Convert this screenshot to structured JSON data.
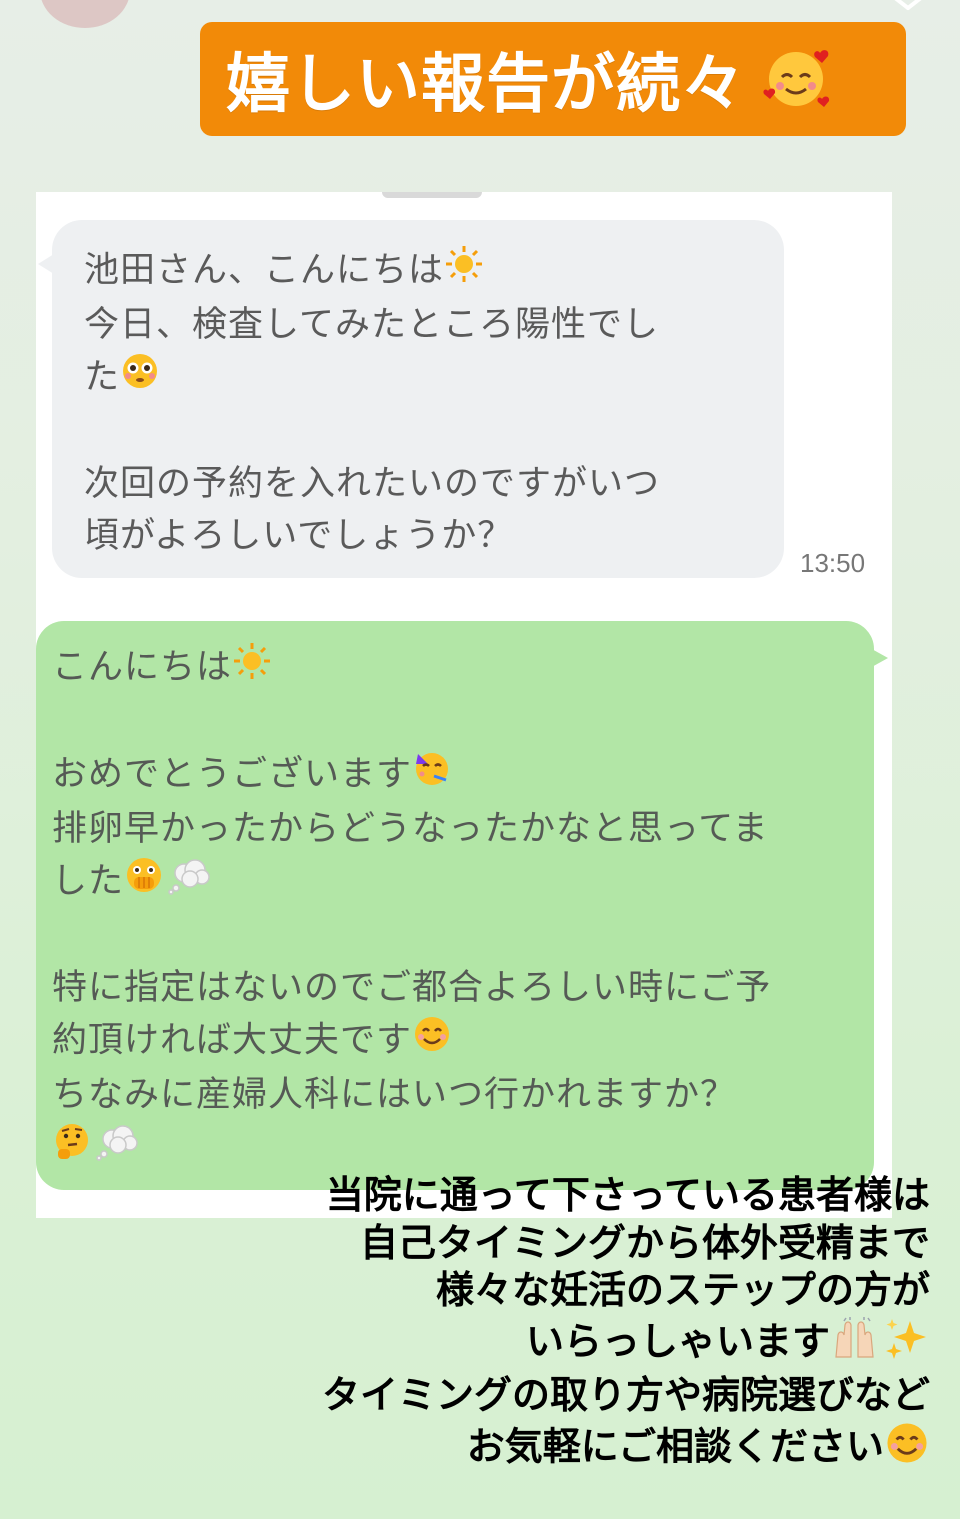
{
  "banner": {
    "title": "嬉しい報告が続々",
    "emoji": "smiling-face-with-hearts-emoji"
  },
  "chat": {
    "incoming": {
      "lines": [
        {
          "text": "池田さん、こんにちは",
          "emoji": "sun-emoji"
        },
        {
          "text": "今日、検査してみたところ陽性でし"
        },
        {
          "text": "た",
          "emoji": "flushed-face-emoji"
        },
        {
          "text": ""
        },
        {
          "text": "次回の予約を入れたいのですがいつ"
        },
        {
          "text": "頃がよろしいでしょうか？"
        }
      ],
      "time": "13:50"
    },
    "outgoing": {
      "lines": [
        {
          "text": "こんにちは",
          "emoji": "sun-emoji"
        },
        {
          "text": ""
        },
        {
          "text": "おめでとうございます",
          "emoji": "partying-face-emoji"
        },
        {
          "text": "排卵早かったからどうなったかなと思ってま"
        },
        {
          "text": "した",
          "emoji": "face-with-open-eyes-and-hand-over-mouth-emoji",
          "emoji2": "thought-balloon-emoji"
        },
        {
          "text": ""
        },
        {
          "text": "特に指定はないのでご都合よろしい時にご予"
        },
        {
          "text": "約頂ければ大丈夫です",
          "emoji": "smiling-face-emoji"
        },
        {
          "text": "ちなみに産婦人科にはいつ行かれますか？"
        },
        {
          "text": "",
          "emoji": "thinking-face-emoji",
          "emoji2": "thought-balloon-emoji"
        }
      ]
    }
  },
  "caption": {
    "lines": [
      "当院に通って下さっている患者様は",
      "自己タイミングから体外受精まで",
      "様々な妊活のステップの方が",
      "いらっしゃいます",
      "タイミングの取り方や病院選びなど",
      "お気軽にご相談ください"
    ],
    "emojis": [
      "raising-hands-emoji",
      "sparkles-emoji",
      "smiling-face-emoji"
    ]
  },
  "colors": {
    "banner": "#f28a08",
    "incoming_bubble": "#eef0f2",
    "outgoing_bubble": "#b2e6a6",
    "background": "#dbf0d6"
  }
}
